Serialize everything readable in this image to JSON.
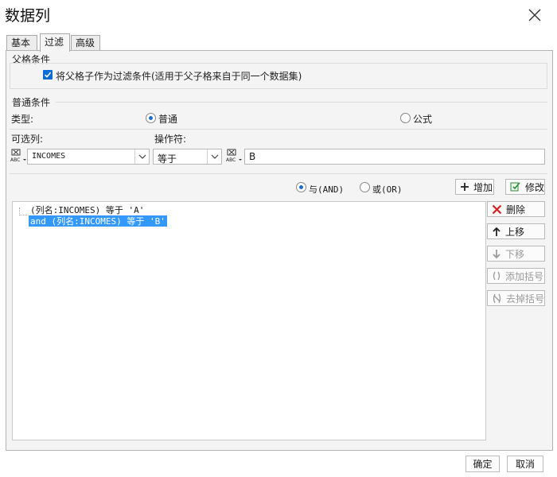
{
  "window": {
    "title": "数据列"
  },
  "tabs": [
    {
      "label": "基本",
      "active": false
    },
    {
      "label": "过滤",
      "active": true
    },
    {
      "label": "高级",
      "active": false
    }
  ],
  "parent_condition": {
    "heading": "父格条件",
    "checkbox_label": "将父格子作为过滤条件(适用于父子格来自于同一个数据集)",
    "checked": true
  },
  "normal_condition": {
    "heading": "普通条件",
    "type_label": "类型:",
    "type_options": [
      {
        "label": "普通",
        "selected": true
      },
      {
        "label": "公式",
        "selected": false
      }
    ],
    "column_label": "可选列:",
    "operator_label": "操作符:",
    "column_value": "INCOMES",
    "operator_value": "等于",
    "value_input": "B"
  },
  "logic": {
    "options": [
      {
        "label": "与(AND)",
        "selected": true
      },
      {
        "label": "或(OR)",
        "selected": false
      }
    ]
  },
  "buttons": {
    "add": "增加",
    "modify": "修改",
    "delete": "删除",
    "move_up": "上移",
    "move_down": "下移",
    "add_bracket": "添加括号",
    "remove_bracket": "去掉括号",
    "ok": "确定",
    "cancel": "取消"
  },
  "conditions": [
    {
      "text": "(列名:INCOMES) 等于 'A'",
      "selected": false
    },
    {
      "text": "and (列名:INCOMES) 等于 'B'",
      "selected": true
    }
  ],
  "colors": {
    "accent": "#0a6ad6",
    "selection": "#3399ff",
    "delete_red": "#d62020",
    "modify_green": "#2e8b3a"
  }
}
